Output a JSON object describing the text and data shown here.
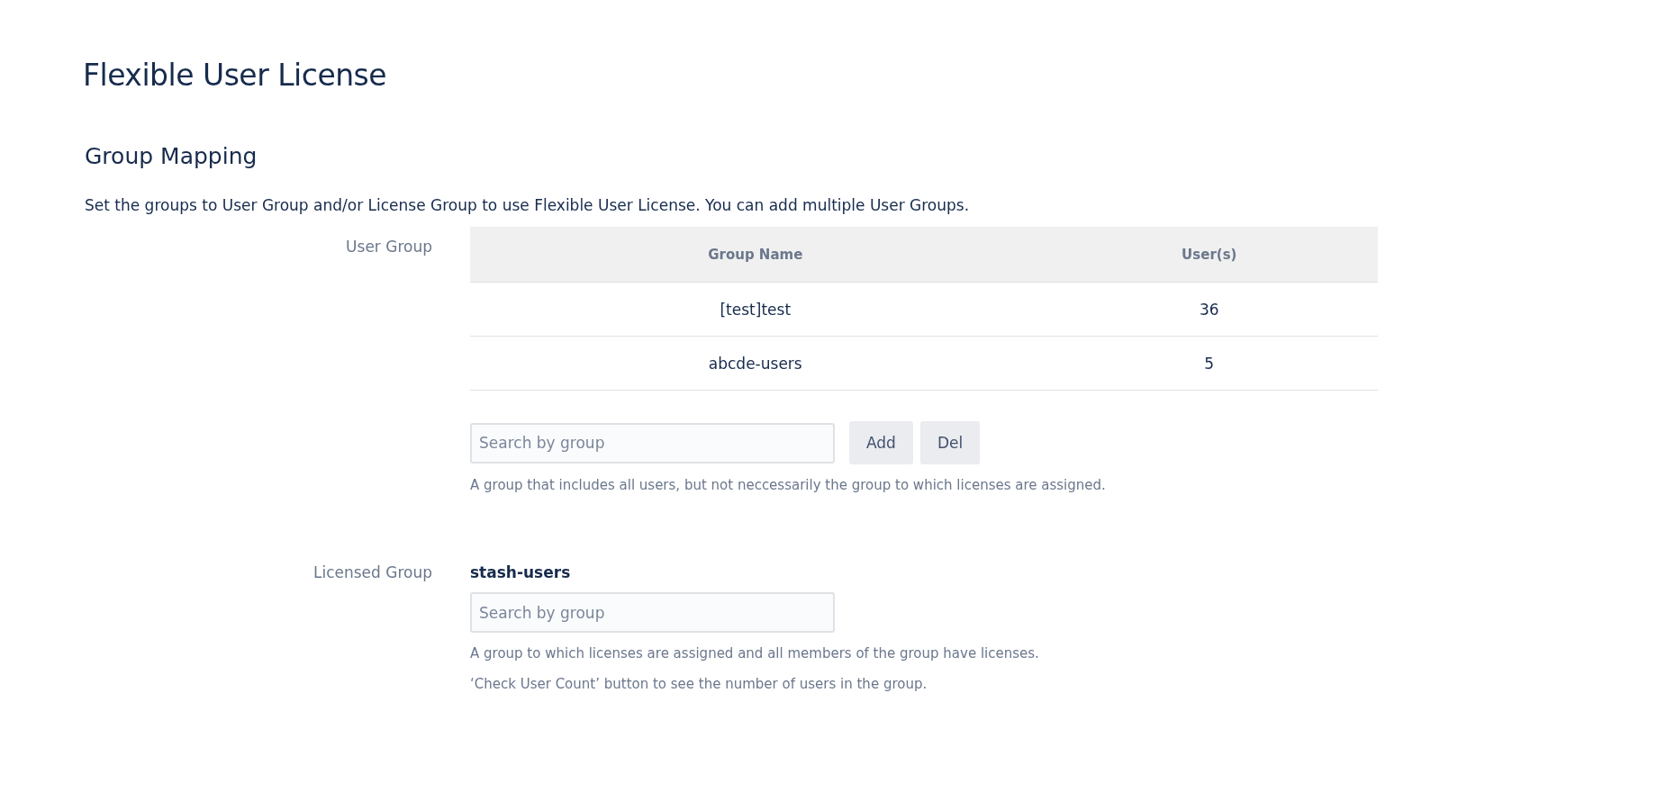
{
  "title": "Flexible User License",
  "section": {
    "heading": "Group Mapping",
    "description": "Set the groups to User Group and/or License Group to use Flexible User License. You can add multiple User Groups."
  },
  "user_group": {
    "label": "User Group",
    "table": {
      "columns": [
        "Group Name",
        "User(s)"
      ],
      "rows": [
        [
          "[test]test",
          "36"
        ],
        [
          "abcde-users",
          "5"
        ]
      ]
    },
    "search": {
      "placeholder": "Search by group"
    },
    "buttons": [
      "Add",
      "Del"
    ],
    "help": [
      "A group that includes all users, but not neccessarily the group to which licenses are assigned."
    ]
  },
  "licensed_group": {
    "label": "Licensed Group",
    "value": "stash-users",
    "search": {
      "placeholder": "Search by group"
    },
    "help": [
      "A group to which licenses are assigned and all members of the group have licenses.",
      "‘Check User Count’ button to see the number of users in the group."
    ]
  }
}
